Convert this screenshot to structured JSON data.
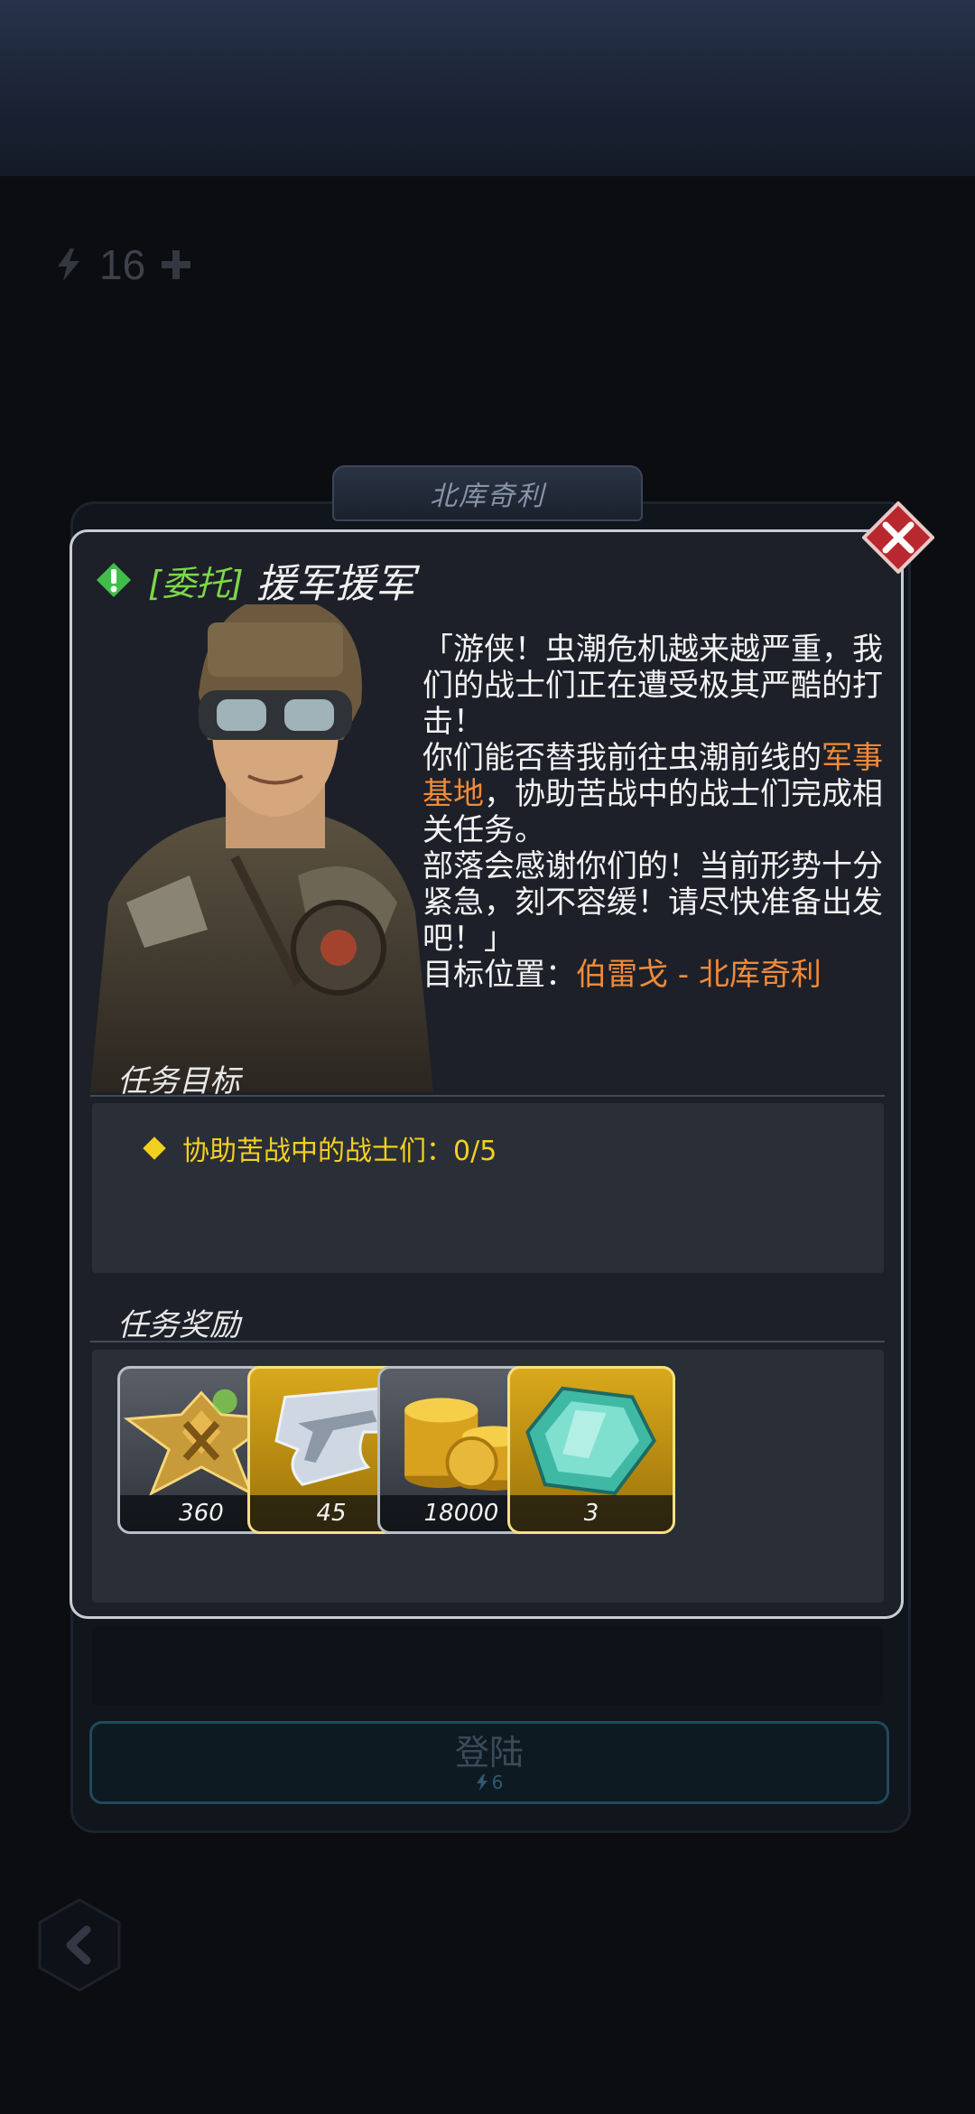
{
  "background": {
    "counter_value": "16",
    "location_tab": "北库奇利",
    "login_button": {
      "label": "登陆",
      "cost": "6"
    }
  },
  "dialog": {
    "tag": "[委托]",
    "title": "援军援军",
    "story": {
      "part1": "「游侠！虫潮危机越来越严重，我们的战士们正在遭受极其严酷的打击！",
      "part2_pre": "你们能否替我前往虫潮前线的",
      "part2_highlight": "军事基地",
      "part2_post": "，协助苦战中的战士们完成相关任务。",
      "part3": "部落会感谢你们的！当前形势十分紧急，刻不容缓！请尽快准备出发吧！」",
      "target_label": "目标位置：",
      "target_value": "伯雷戈 - 北库奇利"
    },
    "objectives_title": "任务目标",
    "objective": "协助苦战中的战士们：0/5",
    "rewards_title": "任务奖励",
    "rewards": [
      {
        "icon": "rank-emblem-icon",
        "count": "360",
        "style": "grey"
      },
      {
        "icon": "weapon-blueprint-icon",
        "count": "45",
        "style": "gold"
      },
      {
        "icon": "gold-coins-icon",
        "count": "18000",
        "style": "grey"
      },
      {
        "icon": "crystal-gem-icon",
        "count": "3",
        "style": "gold"
      }
    ]
  },
  "colors": {
    "accent_green": "#7cd84a",
    "highlight_orange": "#f08a3a",
    "objective_yellow": "#f3d020",
    "close_red": "#b8282e"
  }
}
